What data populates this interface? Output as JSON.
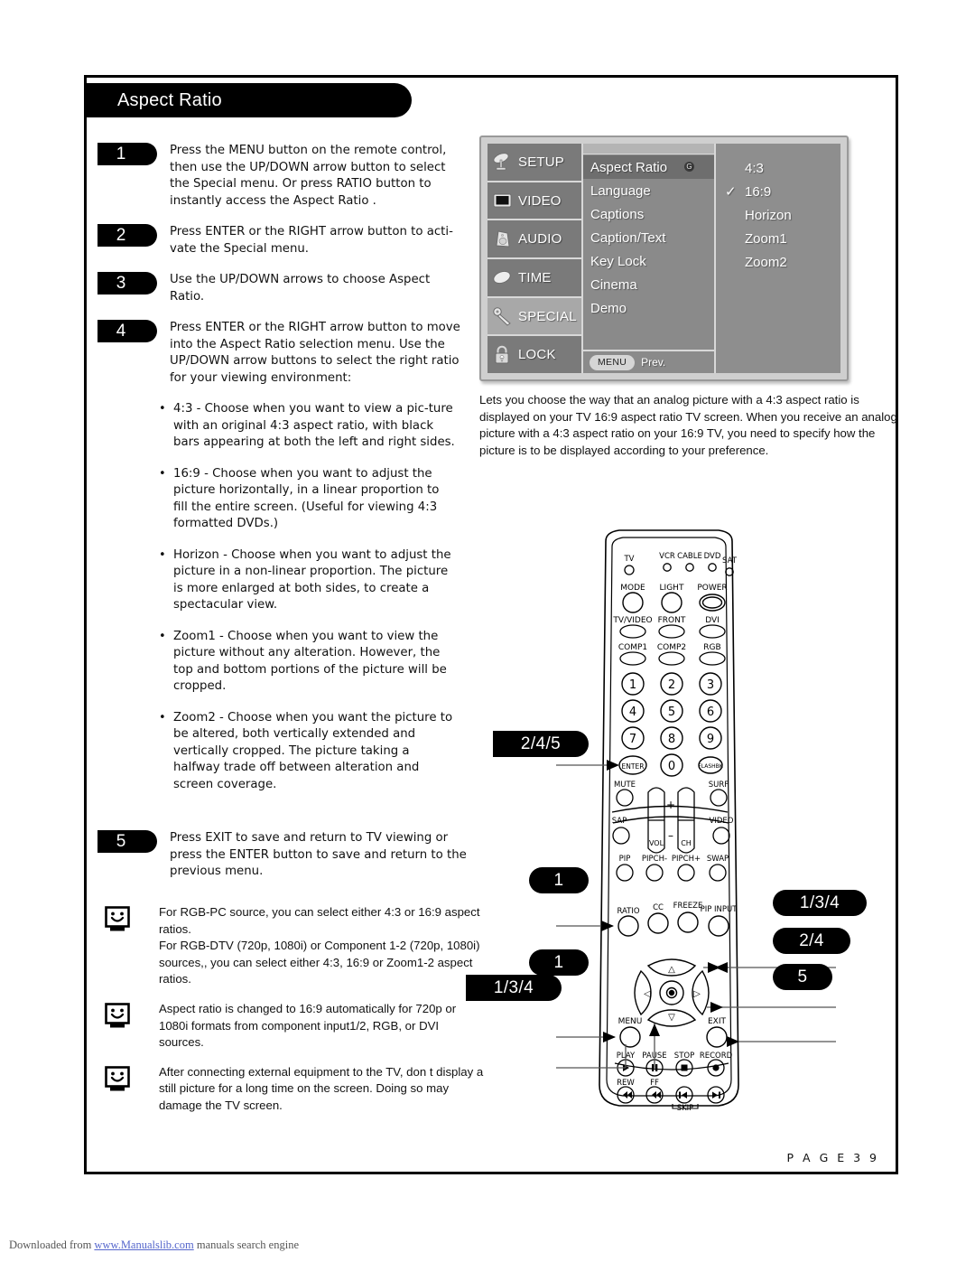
{
  "page": {
    "title": "Aspect Ratio",
    "page_label": "P A G E  3 9"
  },
  "steps": [
    {
      "num": "1",
      "text": "Press the MENU button on the remote control, then use the UP/DOWN arrow button to select the Special menu. Or press RATIO button to instantly access the Aspect Ratio ."
    },
    {
      "num": "2",
      "text": "Press ENTER or the RIGHT arrow button to acti-vate the Special menu."
    },
    {
      "num": "3",
      "text": "Use the UP/DOWN arrows to choose Aspect Ratio."
    },
    {
      "num": "4",
      "text": "Press ENTER or the RIGHT arrow button to move into the Aspect Ratio selection menu. Use the UP/DOWN arrow buttons to select the right ratio for your viewing environment:"
    }
  ],
  "bullets": [
    "4:3 - Choose when you want to view a pic-ture with an original 4:3 aspect ratio, with black bars appearing at both the left and right sides.",
    "16:9 - Choose when you want to adjust the picture horizontally, in a linear proportion to fill the entire screen. (Useful for viewing 4:3 formatted DVDs.)",
    "Horizon - Choose when you want to adjust the picture in a non-linear proportion. The picture is more enlarged at both sides, to create a spectacular view.",
    "Zoom1 - Choose when you want to view the picture without any alteration. However, the top and bottom portions of the picture will be cropped.",
    "Zoom2 - Choose when you want the picture to be altered, both vertically extended and vertically cropped. The picture taking a halfway trade off between alteration and screen coverage."
  ],
  "step5": {
    "num": "5",
    "text": "Press EXIT to save and return to TV viewing or press the ENTER button to save and return to the previous menu."
  },
  "notes": [
    {
      "icon": "smiley-note-icon",
      "text": "For RGB-PC source, you can select either 4:3 or 16:9 aspect ratios.\nFor RGB-DTV (720p, 1080i) or Component 1-2 (720p, 1080i) sources,, you can select either 4:3, 16:9 or Zoom1-2 aspect ratios."
    },
    {
      "icon": "smiley-note-icon",
      "text": "Aspect ratio is changed to 16:9 automatically for 720p or 1080i formats from component input1/2, RGB, or DVI sources."
    },
    {
      "icon": "smiley-note-icon",
      "text": "After connecting external equipment to the TV, don t display a still picture for a long time on the screen. Doing so may damage the TV screen."
    }
  ],
  "tv_menu": {
    "categories": [
      {
        "label": "SETUP",
        "icon": "satellite-dish-icon",
        "active": false
      },
      {
        "label": "VIDEO",
        "icon": "tv-screen-icon",
        "active": false
      },
      {
        "label": "AUDIO",
        "icon": "speaker-icon",
        "active": false
      },
      {
        "label": "TIME",
        "icon": "clock-disc-icon",
        "active": false
      },
      {
        "label": "SPECIAL",
        "icon": "key-icon",
        "active": true
      },
      {
        "label": "LOCK",
        "icon": "padlock-icon",
        "active": false
      }
    ],
    "items": [
      {
        "label": "Aspect Ratio",
        "selected": true,
        "badge": "G"
      },
      {
        "label": "Language",
        "selected": false,
        "badge": ""
      },
      {
        "label": "Captions",
        "selected": false,
        "badge": ""
      },
      {
        "label": "Caption/Text",
        "selected": false,
        "badge": ""
      },
      {
        "label": "Key Lock",
        "selected": false,
        "badge": ""
      },
      {
        "label": "Cinema",
        "selected": false,
        "badge": ""
      },
      {
        "label": "Demo",
        "selected": false,
        "badge": ""
      }
    ],
    "options": [
      {
        "label": "4:3",
        "checked": false
      },
      {
        "label": "16:9",
        "checked": true
      },
      {
        "label": "Horizon",
        "checked": false
      },
      {
        "label": "Zoom1",
        "checked": false
      },
      {
        "label": "Zoom2",
        "checked": false
      }
    ],
    "footer": {
      "menu_button": "MENU",
      "prev_label": "Prev."
    }
  },
  "right_paragraph": "Lets you choose the way that an analog picture with a 4:3 aspect ratio is displayed on your TV 16:9 aspect ratio TV screen. When you receive an analog picture with a 4:3 aspect ratio on your 16:9 TV, you need to specify how the picture is to be displayed according to your preference.",
  "callouts": [
    {
      "id": "callout-245",
      "label": "2/4/5"
    },
    {
      "id": "callout-ratio-1",
      "label": "1"
    },
    {
      "id": "callout-menu-1",
      "label": "1"
    },
    {
      "id": "callout-134-left",
      "label": "1/3/4"
    },
    {
      "id": "callout-134-right",
      "label": "1/3/4"
    },
    {
      "id": "callout-24-right",
      "label": "2/4"
    },
    {
      "id": "callout-5-right",
      "label": "5"
    }
  ],
  "remote": {
    "mode_leds": [
      "TV",
      "VCR",
      "CABLE",
      "DVD",
      "SAT"
    ],
    "row_mode": [
      "MODE",
      "LIGHT",
      "POWER"
    ],
    "row_input": [
      "TV/VIDEO",
      "FRONT",
      "DVI"
    ],
    "row_comp": [
      "COMP1",
      "COMP2",
      "RGB"
    ],
    "keypad": [
      "1",
      "2",
      "3",
      "4",
      "5",
      "6",
      "7",
      "8",
      "9",
      "ENTER",
      "0",
      "FLASHBK"
    ],
    "mute": "MUTE",
    "surf": "SURF",
    "sap": "SAP",
    "video": "VIDEO",
    "vol": "VOL",
    "ch": "CH",
    "plus": "+",
    "minus": "–",
    "pip_row": [
      "PIP",
      "PIPCH-",
      "PIPCH+",
      "SWAP"
    ],
    "fn_row": [
      "RATIO",
      "CC",
      "FREEZE",
      "PIP INPUT"
    ],
    "nav": {
      "up": "△",
      "down": "▽",
      "left": "◁",
      "right": "▷",
      "menu": "MENU",
      "exit": "EXIT"
    },
    "transport": [
      "PLAY",
      "PAUSE",
      "STOP",
      "RECORD"
    ],
    "transport2": [
      "REW",
      "FF"
    ],
    "skip": "SKIP"
  },
  "footer": {
    "prefix": "Downloaded from ",
    "link": "www.Manualslib.com",
    "suffix": " manuals search engine"
  }
}
